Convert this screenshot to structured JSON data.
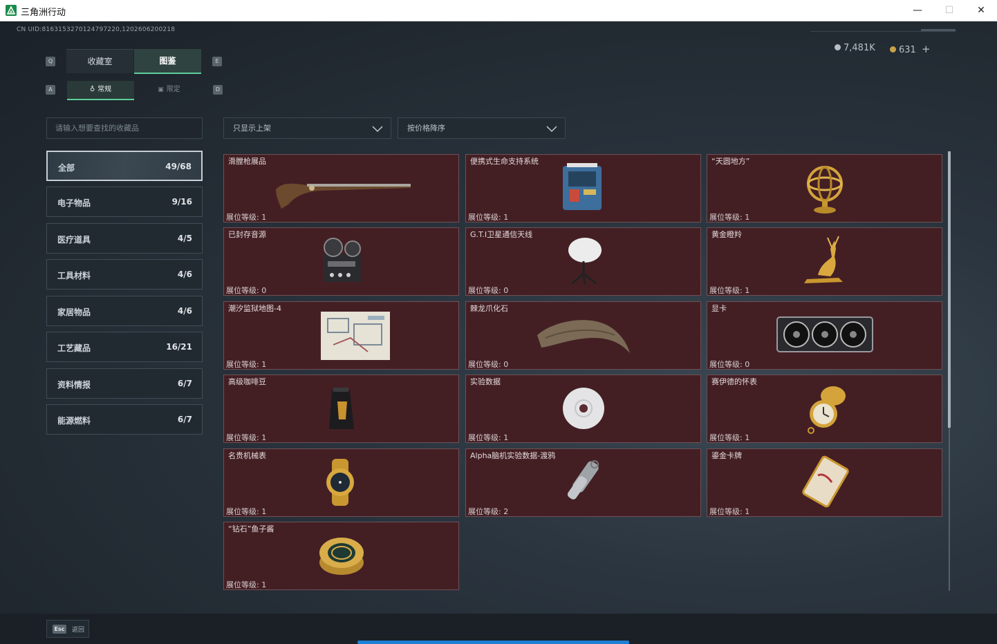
{
  "window": {
    "title": "三角洲行动",
    "minimize": "—",
    "maximize": "☐",
    "close": "✕"
  },
  "header": {
    "uid": "CN UID:8163153270124797220,1202606200218",
    "currency_silver": "7,481K",
    "currency_gold": "631",
    "add": "+"
  },
  "tabs": {
    "key_left": "Q",
    "key_right": "E",
    "items": [
      {
        "label": "收藏室",
        "active": false
      },
      {
        "label": "图鉴",
        "active": true
      }
    ]
  },
  "subtabs": {
    "key_left": "A",
    "key_right": "D",
    "items": [
      {
        "label": "常规",
        "active": true
      },
      {
        "label": "限定",
        "active": false
      }
    ]
  },
  "search": {
    "placeholder": "请输入想要查找的收藏品"
  },
  "filters": {
    "show": "只显示上架",
    "sort": "按价格降序"
  },
  "categories": [
    {
      "label": "全部",
      "count": "49/68",
      "active": true
    },
    {
      "label": "电子物品",
      "count": "9/16",
      "active": false
    },
    {
      "label": "医疗道具",
      "count": "4/5",
      "active": false
    },
    {
      "label": "工具材料",
      "count": "4/6",
      "active": false
    },
    {
      "label": "家居物品",
      "count": "4/6",
      "active": false
    },
    {
      "label": "工艺藏品",
      "count": "16/21",
      "active": false
    },
    {
      "label": "资料情报",
      "count": "6/7",
      "active": false
    },
    {
      "label": "能源燃料",
      "count": "6/7",
      "active": false
    }
  ],
  "level_label": "展位等级:",
  "items": [
    {
      "name": "滑膛枪展品",
      "level": "1",
      "icon": "musket-icon"
    },
    {
      "name": "便携式生命支持系统",
      "level": "1",
      "icon": "life-support-icon"
    },
    {
      "name": "“天圆地方”",
      "level": "1",
      "icon": "armillary-sphere-icon"
    },
    {
      "name": "已封存音源",
      "level": "0",
      "icon": "reel-recorder-icon"
    },
    {
      "name": "G.T.I卫星通信天线",
      "level": "0",
      "icon": "satellite-dish-icon"
    },
    {
      "name": "黄金瞪羚",
      "level": "1",
      "icon": "gold-gazelle-icon"
    },
    {
      "name": "潮汐监狱地图-4",
      "level": "1",
      "icon": "prison-map-icon"
    },
    {
      "name": "棘龙爪化石",
      "level": "0",
      "icon": "claw-fossil-icon"
    },
    {
      "name": "显卡",
      "level": "0",
      "icon": "graphics-card-icon"
    },
    {
      "name": "高级咖啡豆",
      "level": "1",
      "icon": "coffee-bag-icon"
    },
    {
      "name": "实验数据",
      "level": "1",
      "icon": "data-disc-icon"
    },
    {
      "name": "赛伊德的怀表",
      "level": "1",
      "icon": "pocket-watch-icon"
    },
    {
      "name": "名贵机械表",
      "level": "1",
      "icon": "wristwatch-icon"
    },
    {
      "name": "Alpha脑机实验数据-渡鸦",
      "level": "2",
      "icon": "data-capsule-icon"
    },
    {
      "name": "鎏金卡牌",
      "level": "1",
      "icon": "gilded-card-icon"
    },
    {
      "name": "“钻石”鱼子酱",
      "level": "1",
      "icon": "caviar-tin-icon"
    }
  ],
  "footer": {
    "esc_key": "Esc",
    "back": "返回"
  },
  "colors": {
    "card_bg": "#431f24",
    "accent": "#5ecf9a",
    "progress": "#1e7fd6"
  }
}
